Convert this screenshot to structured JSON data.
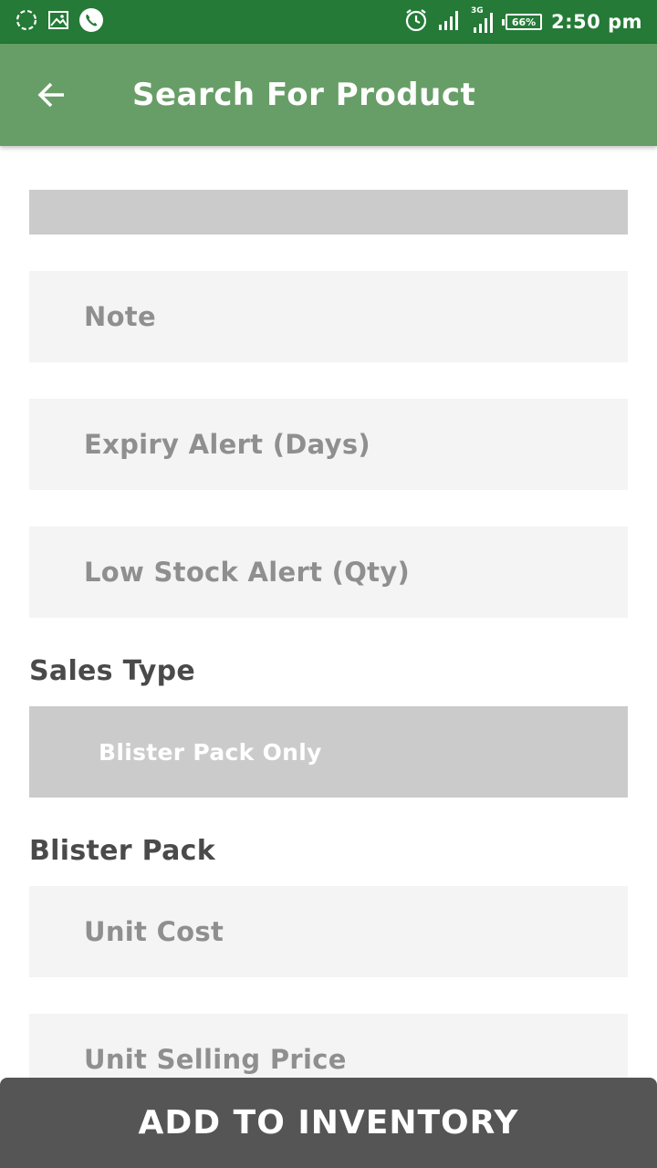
{
  "status_bar": {
    "battery": "66%",
    "network": "3G",
    "time": "2:50 pm"
  },
  "app_bar": {
    "title": "Search For Product",
    "back_icon": "arrow-left-icon"
  },
  "form": {
    "note_placeholder": "Note",
    "expiry_alert_placeholder": "Expiry Alert (Days)",
    "low_stock_alert_placeholder": "Low Stock Alert (Qty)",
    "sales_type_label": "Sales Type",
    "sales_type_value": "Blister Pack Only",
    "blister_pack_label": "Blister Pack",
    "unit_cost_placeholder": "Unit Cost",
    "unit_selling_price_placeholder": "Unit Selling Price"
  },
  "actions": {
    "add_to_inventory": "ADD TO INVENTORY"
  },
  "colors": {
    "status_bar": "#247a36",
    "app_bar": "#679e67",
    "field_bg": "#f4f4f4",
    "select_bg": "#cbcbcb",
    "button_bg": "#555555"
  }
}
